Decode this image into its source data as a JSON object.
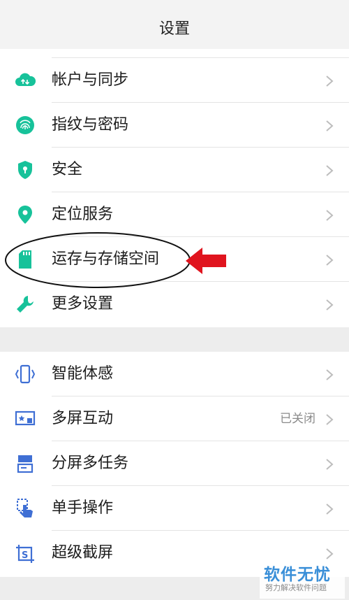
{
  "header": {
    "title": "设置"
  },
  "group1": {
    "items": [
      {
        "label": "帐户与同步",
        "icon": "cloud-sync-icon"
      },
      {
        "label": "指纹与密码",
        "icon": "fingerprint-icon"
      },
      {
        "label": "安全",
        "icon": "shield-icon"
      },
      {
        "label": "定位服务",
        "icon": "location-pin-icon"
      },
      {
        "label": "运存与存储空间",
        "icon": "sd-card-icon"
      },
      {
        "label": "更多设置",
        "icon": "wrench-icon"
      }
    ]
  },
  "group2": {
    "items": [
      {
        "label": "智能体感",
        "icon": "motion-phone-icon"
      },
      {
        "label": "多屏互动",
        "icon": "screen-cast-icon",
        "status": "已关闭"
      },
      {
        "label": "分屏多任务",
        "icon": "split-screen-icon"
      },
      {
        "label": "单手操作",
        "icon": "one-hand-icon"
      },
      {
        "label": "超级截屏",
        "icon": "screenshot-icon"
      }
    ]
  },
  "colors": {
    "green_icon": "#17c29a",
    "blue_icon": "#3f6fd4",
    "annotation_arrow": "#e0141e",
    "chevron": "#bdbdbd"
  },
  "watermark": {
    "main": "软件无忧",
    "sub": "努力解决软件问题"
  }
}
